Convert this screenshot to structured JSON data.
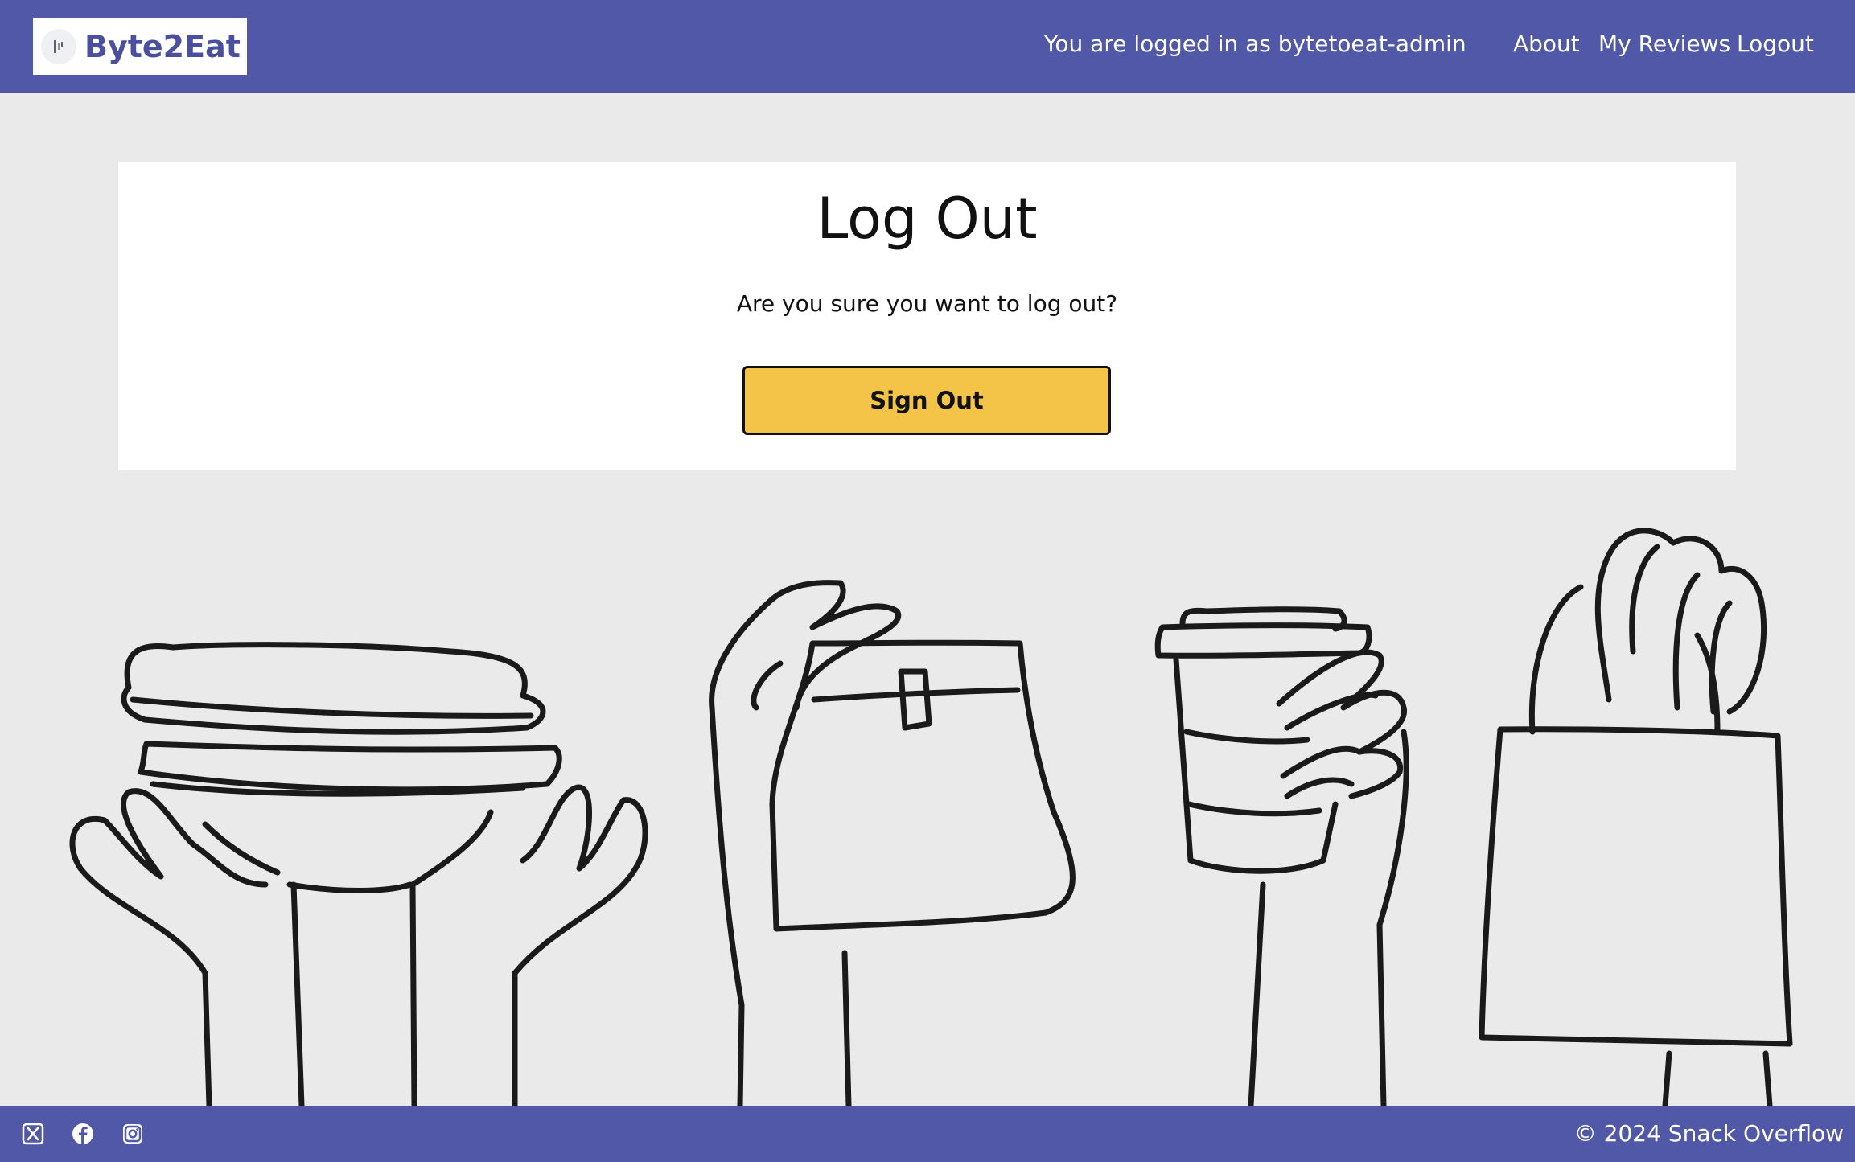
{
  "header": {
    "brand": {
      "name": "Byte2Eat",
      "logo_icon": "brand-logo-icon"
    },
    "login_status": "You are logged in as bytetoeat-admin",
    "nav": [
      {
        "label": "About"
      },
      {
        "label": "My Reviews"
      },
      {
        "label": "Logout"
      }
    ]
  },
  "main": {
    "title": "Log Out",
    "question": "Are you sure you want to log out?",
    "signout_button": "Sign Out"
  },
  "illustration": {
    "name": "hands-holding-food-illustration"
  },
  "footer": {
    "social": [
      {
        "icon": "x-twitter-icon"
      },
      {
        "icon": "facebook-icon"
      },
      {
        "icon": "instagram-icon"
      }
    ],
    "copyright": "© 2024 Snack Overflow"
  },
  "colors": {
    "primary": "#5158a8",
    "button": "#f3c447",
    "background": "#eaeaea",
    "card": "#ffffff"
  }
}
